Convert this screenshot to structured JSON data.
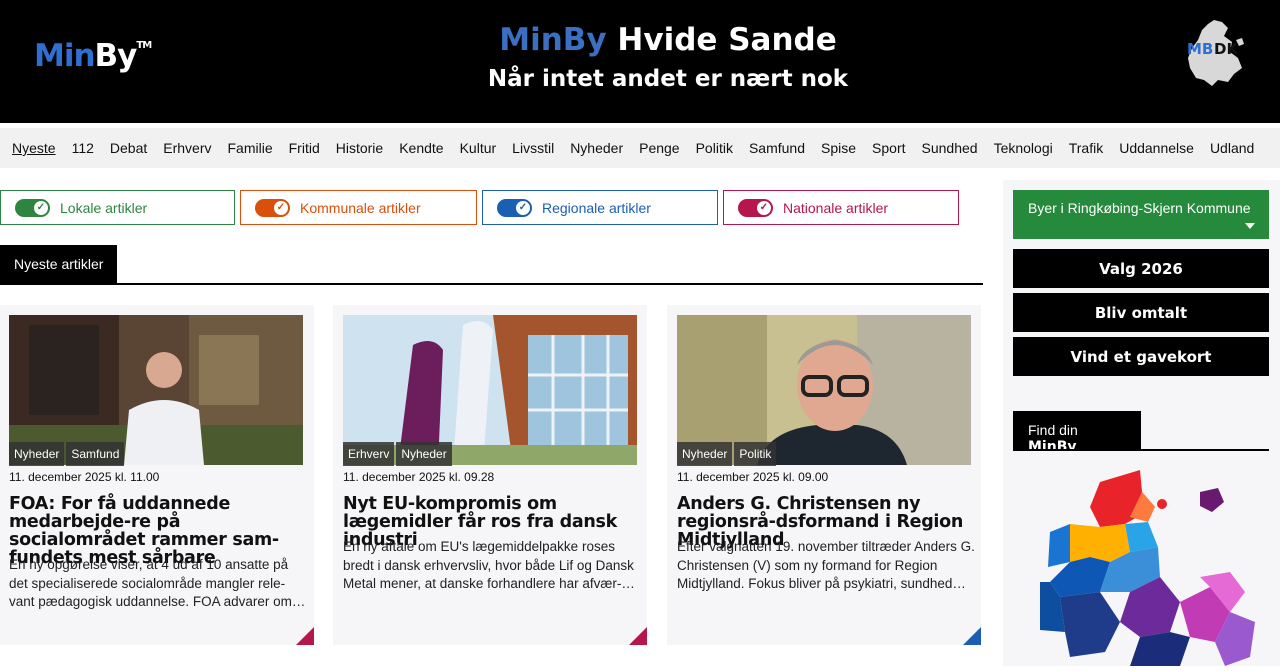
{
  "header": {
    "logo_min": "Min",
    "logo_by": "By",
    "logo_tm": "TM",
    "site_minby": "MinBy",
    "site_city": "Hvide Sande",
    "tagline": "Når intet andet er nært nok",
    "badge": "MBDK"
  },
  "nav": [
    "Nyeste",
    "112",
    "Debat",
    "Erhverv",
    "Familie",
    "Fritid",
    "Historie",
    "Kendte",
    "Kultur",
    "Livsstil",
    "Nyheder",
    "Penge",
    "Politik",
    "Samfund",
    "Spise",
    "Sport",
    "Sundhed",
    "Teknologi",
    "Trafik",
    "Uddannelse",
    "Udland"
  ],
  "filters": [
    {
      "label": "Lokale artikler",
      "color": "#2e8540"
    },
    {
      "label": "Kommunale artikler",
      "color": "#d94f0c"
    },
    {
      "label": "Regionale artikler",
      "color": "#1a5fb4"
    },
    {
      "label": "Nationale artikler",
      "color": "#b5174d"
    }
  ],
  "section_tab": "Nyeste artikler",
  "articles": [
    {
      "tags": [
        "Nyheder",
        "Samfund"
      ],
      "date": "11. december 2025 kl. 11.00",
      "headline": "FOA: For få uddannede medarbejde-re på socialområdet rammer sam-fundets mest sårbare",
      "teaser": "En ny opgørelse viser, at 4 ud af 10 ansatte på det specialiserede socialområde mangler rele-vant pædagogisk uddannelse. FOA advarer om…",
      "corner_color": "#b5174d"
    },
    {
      "tags": [
        "Erhverv",
        "Nyheder"
      ],
      "date": "11. december 2025 kl. 09.28",
      "headline": "Nyt EU-kompromis om lægemidler får ros fra dansk industri",
      "teaser": "En ny aftale om EU's lægemiddelpakke roses bredt i dansk erhvervsliv, hvor både Lif og Dansk Metal mener, at danske forhandlere har afvær-…",
      "corner_color": "#b5174d"
    },
    {
      "tags": [
        "Nyheder",
        "Politik"
      ],
      "date": "11. december 2025 kl. 09.00",
      "headline": "Anders G. Christensen ny regionsrå-dsformand i Region Midtjylland",
      "teaser": "Efter valgnatten 19. november tiltræder Anders G. Christensen (V) som ny formand for Region Midtjylland. Fokus bliver på psykiatri, sundhed…",
      "corner_color": "#1a5fb4"
    }
  ],
  "sidebar": {
    "kommune_label": "Byer i Ringkøbing-Skjern Kommune",
    "buttons": [
      "Valg 2026",
      "Bliv omtalt",
      "Vind et gavekort"
    ],
    "find_prefix": "Find din ",
    "find_brand": "MinBy"
  }
}
